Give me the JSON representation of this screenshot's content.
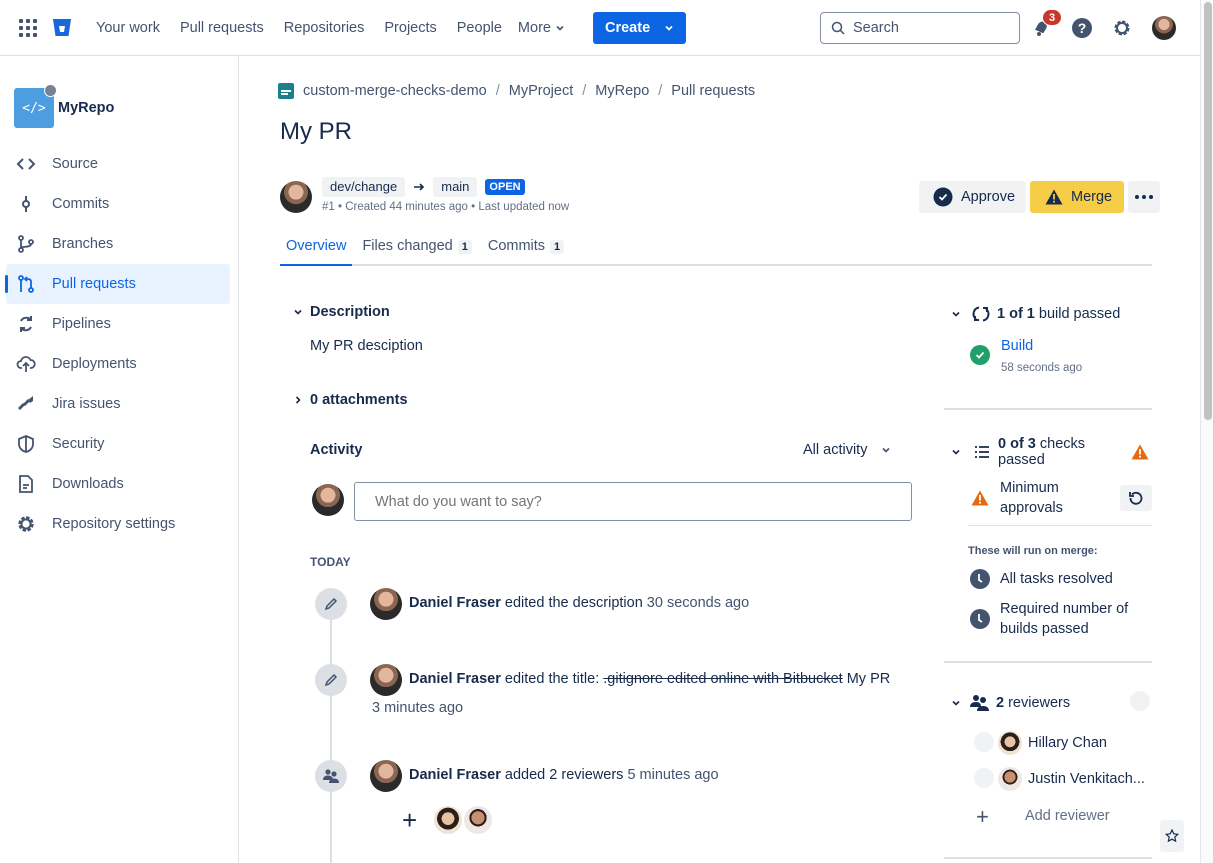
{
  "topnav": {
    "items": [
      "Your work",
      "Pull requests",
      "Repositories",
      "Projects",
      "People"
    ],
    "more_label": "More",
    "create_label": "Create",
    "search_placeholder": "Search",
    "notification_count": "3"
  },
  "sidebar": {
    "repo_name": "MyRepo",
    "items": [
      {
        "label": "Source",
        "icon": "code-icon"
      },
      {
        "label": "Commits",
        "icon": "commit-icon"
      },
      {
        "label": "Branches",
        "icon": "branch-icon"
      },
      {
        "label": "Pull requests",
        "icon": "pull-request-icon",
        "active": true
      },
      {
        "label": "Pipelines",
        "icon": "pipelines-icon"
      },
      {
        "label": "Deployments",
        "icon": "cloud-upload-icon"
      },
      {
        "label": "Jira issues",
        "icon": "jira-icon"
      },
      {
        "label": "Security",
        "icon": "shield-icon"
      },
      {
        "label": "Downloads",
        "icon": "document-icon"
      },
      {
        "label": "Repository settings",
        "icon": "gear-icon"
      }
    ]
  },
  "breadcrumb": [
    "custom-merge-checks-demo",
    "MyProject",
    "MyRepo",
    "Pull requests"
  ],
  "pr": {
    "title": "My PR",
    "source_branch": "dev/change",
    "target_branch": "main",
    "status": "OPEN",
    "meta": "#1 • Created 44 minutes ago • Last updated now",
    "approve_label": "Approve",
    "merge_label": "Merge"
  },
  "tabs": [
    {
      "label": "Overview",
      "active": true
    },
    {
      "label": "Files changed",
      "count": "1"
    },
    {
      "label": "Commits",
      "count": "1"
    }
  ],
  "description": {
    "heading": "Description",
    "text": "My PR desciption",
    "attachments": "0 attachments"
  },
  "activity": {
    "heading": "Activity",
    "filter": "All activity",
    "comment_placeholder": "What do you want to say?",
    "day_label": "TODAY",
    "events": [
      {
        "author": "Daniel Fraser",
        "action": "edited the description",
        "time": "30 seconds ago"
      },
      {
        "author": "Daniel Fraser",
        "action": "edited the title:",
        "old_title": ".gitignore edited online with Bitbucket",
        "new_title": "My PR",
        "time": "3 minutes ago"
      },
      {
        "author": "Daniel Fraser",
        "action": "added 2 reviewers",
        "time": "5 minutes ago"
      }
    ]
  },
  "builds": {
    "summary_bold": "1 of 1",
    "summary_rest": "build passed",
    "name": "Build",
    "time": "58 seconds ago"
  },
  "checks": {
    "summary_bold": "0 of 3",
    "summary_rest": "checks passed",
    "failing": "Minimum approvals",
    "on_merge_heading": "These will run on merge:",
    "pending": [
      "All tasks resolved",
      "Required number of builds passed"
    ]
  },
  "reviewers": {
    "summary_bold": "2",
    "summary_rest": "reviewers",
    "list": [
      "Hillary Chan",
      "Justin Venkitach..."
    ],
    "add_label": "Add reviewer"
  },
  "colors": {
    "brand_blue": "#0c66e4",
    "merge_yellow": "#f5cd47",
    "warning_orange": "#e56910",
    "success_green": "#22a06b",
    "badge_red": "#c9372c"
  }
}
